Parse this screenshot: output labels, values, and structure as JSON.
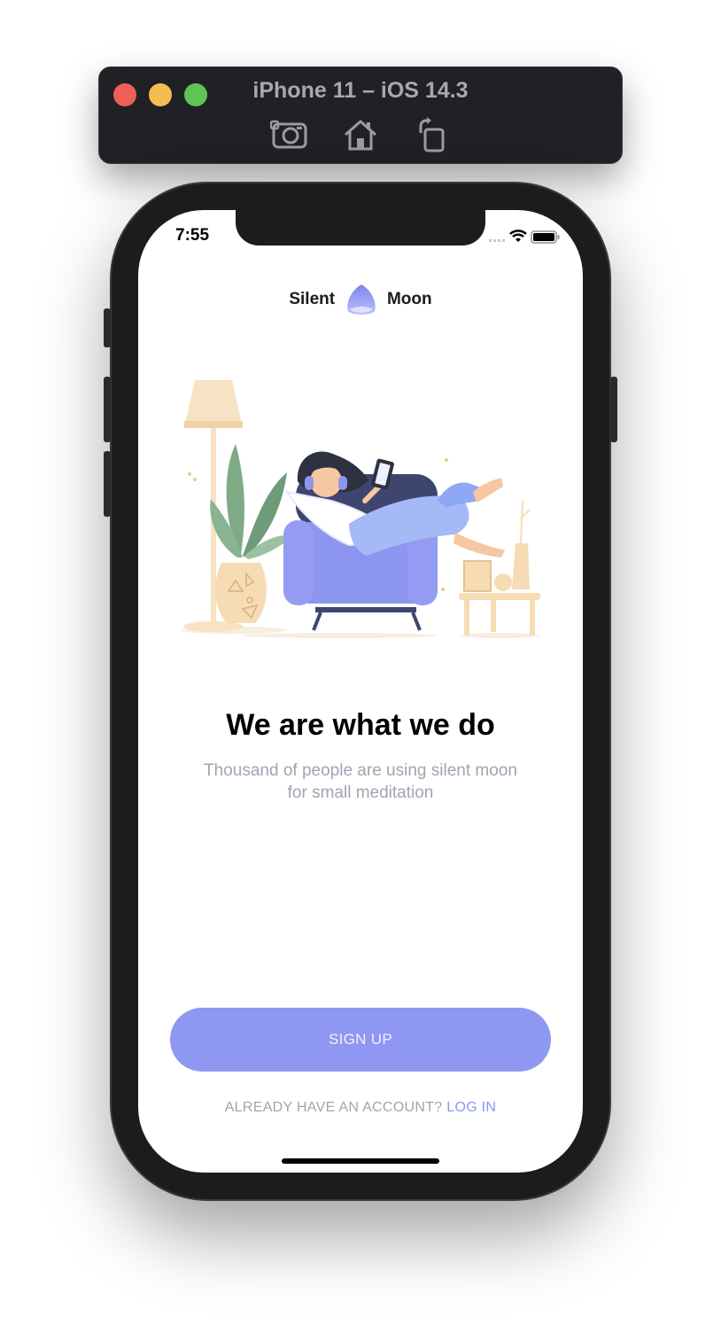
{
  "simulator": {
    "title": "iPhone 11 – iOS 14.3",
    "tools": [
      "screenshot-icon",
      "home-icon",
      "rotate-icon"
    ]
  },
  "status_bar": {
    "time": "7:55",
    "icons": [
      "signal-icon",
      "wifi-icon",
      "battery-icon"
    ]
  },
  "logo": {
    "left_word": "Silent",
    "right_word": "Moon"
  },
  "onboarding": {
    "headline": "We are what we do",
    "subtitle": "Thousand of people are using silent moon for small meditation",
    "illustration": "woman-relaxing-in-armchair-illustration"
  },
  "actions": {
    "signup_label": "SIGN UP",
    "login_prompt": "ALREADY HAVE AN ACCOUNT?",
    "login_label": "LOG IN"
  },
  "colors": {
    "accent": "#8e97f2",
    "text_secondary": "#a1a4b2",
    "sim_red": "#ee5f58",
    "sim_yellow": "#f5bd4f",
    "sim_green": "#5fc454"
  }
}
